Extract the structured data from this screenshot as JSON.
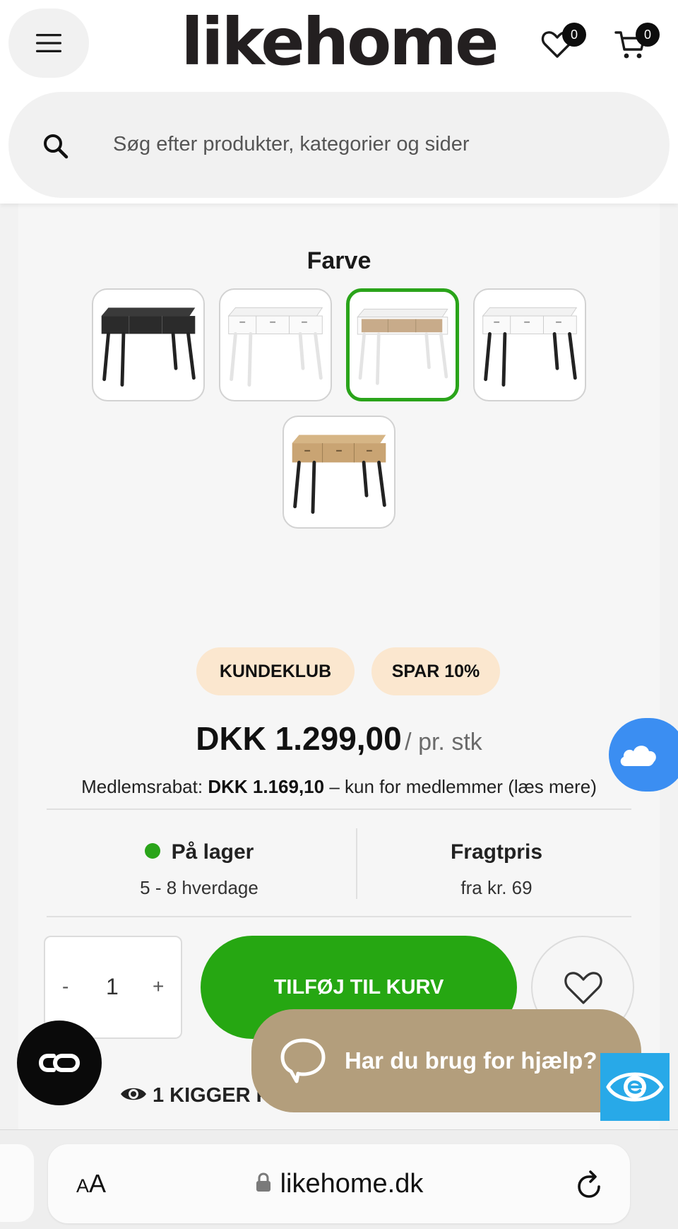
{
  "header": {
    "logo": "likehome",
    "wishlist_count": "0",
    "cart_count": "0",
    "search_placeholder": "Søg efter produkter, kategorier og sider"
  },
  "product": {
    "color_label": "Farve",
    "swatches": [
      {
        "name": "black top, black legs",
        "selected": false
      },
      {
        "name": "white top, white legs",
        "selected": false
      },
      {
        "name": "white with oak drawers",
        "selected": true
      },
      {
        "name": "white top, black legs",
        "selected": false
      },
      {
        "name": "oak top, black legs",
        "selected": false
      }
    ],
    "tags": [
      "KUNDEKLUB",
      "SPAR 10%"
    ],
    "price": "DKK 1.299,00",
    "price_unit": "/ pr. stk",
    "member_prefix": "Medlemsrabat:",
    "member_price": "DKK 1.169,10",
    "member_suffix": "– kun for medlemmer (læs mere)",
    "stock_title": "På lager",
    "stock_delivery": "5 - 8 hverdage",
    "freight_title": "Fragtpris",
    "freight_value": "fra kr. 69",
    "qty_minus": "-",
    "qty_value": "1",
    "qty_plus": "+",
    "add_to_cart": "TILFØJ TIL KURV",
    "viewers": "1 KIGGER PÅ"
  },
  "widgets": {
    "help_text": "Har du brug for hjælp?"
  },
  "browser": {
    "text_size_small": "A",
    "text_size_big": "A",
    "url": "likehome.dk"
  },
  "colors": {
    "accent_green": "#26a712",
    "selected_border": "#2aa41a",
    "tag_bg": "#fbe7cf",
    "help_bg": "#b39e7c",
    "weather_blue": "#3b8ef2",
    "a11y_blue": "#28a9e8"
  }
}
